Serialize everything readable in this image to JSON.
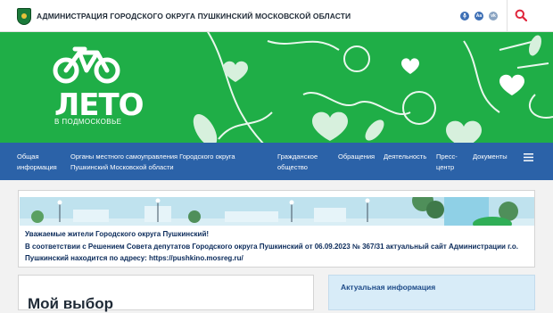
{
  "header": {
    "site_title": "АДМИНИСТРАЦИЯ ГОРОДСКОГО ОКРУГА ПУШКИНСКИЙ МОСКОВСКОЙ ОБЛАСТИ",
    "accessibility_labels": [
      "Aa",
      "vk"
    ],
    "search_icon": "search-icon"
  },
  "banner": {
    "title": "ЛЕТО",
    "subtitle": "В ПОДМОСКОВЬЕ",
    "logo_icon": "bicycle-icon",
    "background_color": "#1fae47"
  },
  "nav": {
    "items": [
      {
        "line1": "Общая",
        "line2": "информация"
      },
      {
        "line1": "Органы местного самоуправления Городского округа",
        "line2": "Пушкинский Московской области"
      },
      {
        "line1": "Гражданское",
        "line2": "общество"
      },
      {
        "line1": "Обращения",
        "line2": ""
      },
      {
        "line1": "Деятельность",
        "line2": ""
      },
      {
        "line1": "Пресс-",
        "line2": "центр"
      },
      {
        "line1": "Документы",
        "line2": ""
      }
    ],
    "menu_icon": "hamburger-icon",
    "background_color": "#2b62a8"
  },
  "notice": {
    "line1": "Уважаемые жители Городского округа Пушкинский!",
    "line2": "В соответствии с Решением Совета депутатов Городского округа Пушкинский от 06.09.2023 № 367/31 актуальный сайт Администрации г.о.",
    "line3_prefix": "Пушкинский находится по адресу: ",
    "link": "https://pushkino.mosreg.ru/"
  },
  "cards": {
    "left_title": "Мой выбор",
    "right_title": "Актуальная информация"
  }
}
